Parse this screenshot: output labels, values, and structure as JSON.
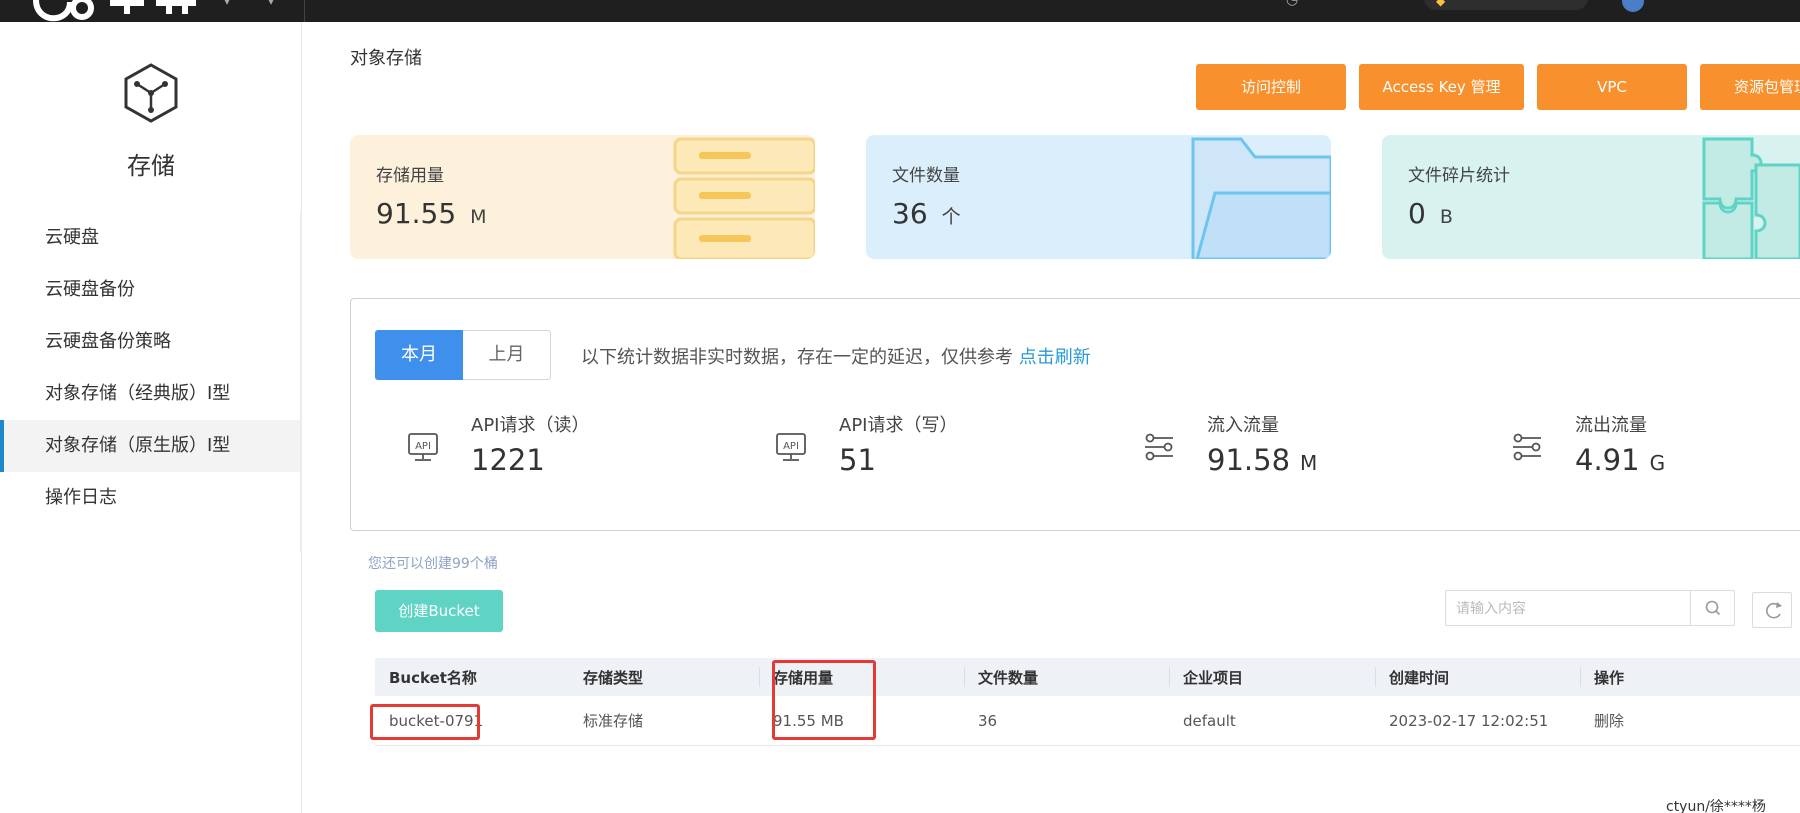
{
  "sidebar": {
    "title": "存储",
    "items": [
      {
        "label": "云硬盘"
      },
      {
        "label": "云硬盘备份"
      },
      {
        "label": "云硬盘备份策略"
      },
      {
        "label": "对象存储（经典版）Ⅰ型"
      },
      {
        "label": "对象存储（原生版）Ⅰ型"
      },
      {
        "label": "操作日志"
      }
    ]
  },
  "header": {
    "title": "对象存储",
    "buttons": [
      "访问控制",
      "Access Key 管理",
      "VPC",
      "资源包管理"
    ]
  },
  "cards": [
    {
      "label": "存储用量",
      "value": "91.55",
      "unit": "M"
    },
    {
      "label": "文件数量",
      "value": "36",
      "unit": "个"
    },
    {
      "label": "文件碎片统计",
      "value": "0",
      "unit": "B"
    }
  ],
  "stats": {
    "tab_current": "本月",
    "tab_last": "上月",
    "note": "以下统计数据非实时数据，存在一定的延迟，仅供参考",
    "refresh_link": "点击刷新",
    "items": [
      {
        "label": "API请求（读）",
        "value": "1221",
        "unit": "",
        "icon": "api-icon"
      },
      {
        "label": "API请求（写）",
        "value": "51",
        "unit": "",
        "icon": "api-icon"
      },
      {
        "label": "流入流量",
        "value": "91.58",
        "unit": "M",
        "icon": "flow-icon"
      },
      {
        "label": "流出流量",
        "value": "4.91",
        "unit": "G",
        "icon": "flow-icon"
      }
    ]
  },
  "buckets": {
    "hint": "您还可以创建99个桶",
    "create_label": "创建Bucket",
    "search_placeholder": "请输入内容",
    "columns": [
      "Bucket名称",
      "存储类型",
      "存储用量",
      "文件数量",
      "企业项目",
      "创建时间",
      "操作"
    ],
    "rows": [
      {
        "name": "bucket-0791",
        "type": "标准存储",
        "usage": "91.55 MB",
        "count": "36",
        "project": "default",
        "created": "2023-02-17 12:02:51",
        "action": "删除"
      }
    ]
  },
  "footer": {
    "user": "ctyun/徐****杨"
  }
}
